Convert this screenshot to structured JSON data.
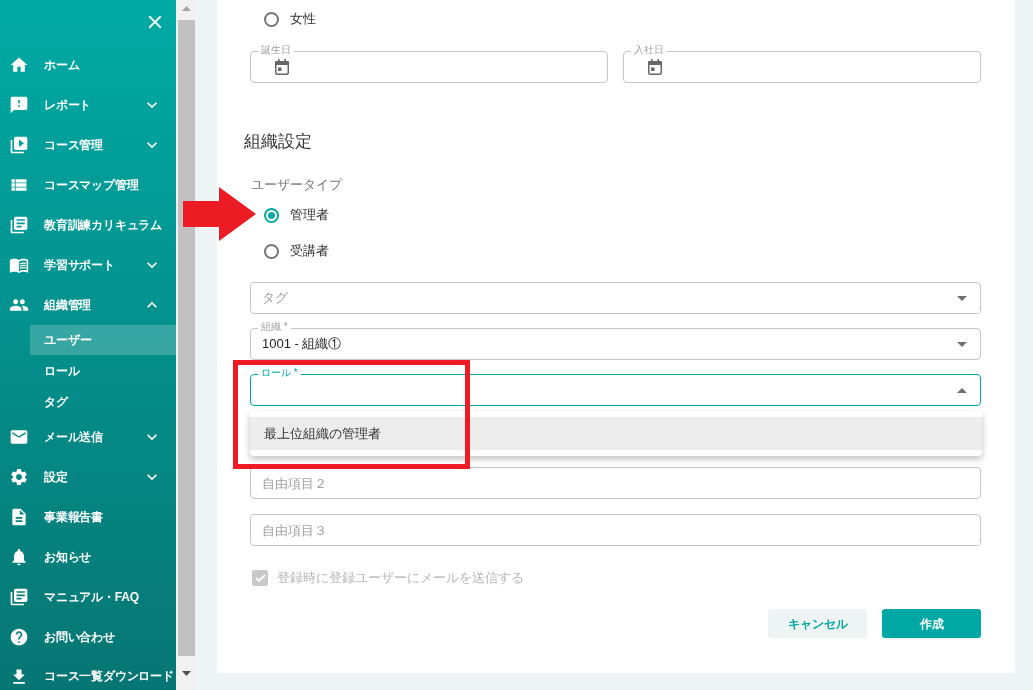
{
  "sidebar": {
    "items": [
      {
        "kind": "link",
        "label": "ホーム"
      },
      {
        "kind": "group",
        "label": "レポート",
        "expanded": false
      },
      {
        "kind": "group",
        "label": "コース管理",
        "expanded": false
      },
      {
        "kind": "link",
        "label": "コースマップ管理"
      },
      {
        "kind": "link",
        "label": "教育訓練カリキュラム"
      },
      {
        "kind": "group",
        "label": "学習サポート",
        "expanded": false
      },
      {
        "kind": "group",
        "label": "組織管理",
        "expanded": true,
        "children": [
          {
            "label": "ユーザー",
            "selected": true
          },
          {
            "label": "ロール",
            "selected": false
          },
          {
            "label": "タグ",
            "selected": false
          }
        ]
      },
      {
        "kind": "group",
        "label": "メール送信",
        "expanded": false
      },
      {
        "kind": "group",
        "label": "設定",
        "expanded": false
      },
      {
        "kind": "link",
        "label": "事業報告書"
      },
      {
        "kind": "link",
        "label": "お知らせ"
      },
      {
        "kind": "link",
        "label": "マニュアル・FAQ"
      },
      {
        "kind": "link",
        "label": "お問い合わせ"
      },
      {
        "kind": "link",
        "label": "コース一覧ダウンロード"
      }
    ]
  },
  "form": {
    "gender_options": [
      {
        "label": "女性",
        "selected": false
      }
    ],
    "date_fields": [
      {
        "label": "誕生日"
      },
      {
        "label": "入社日"
      }
    ],
    "section_title": "組織設定",
    "user_type": {
      "label": "ユーザータイプ",
      "options": [
        {
          "label": "管理者",
          "selected": true
        },
        {
          "label": "受講者",
          "selected": false
        }
      ]
    },
    "selects": [
      {
        "placeholder": "タグ",
        "focused": false,
        "expanded": false
      },
      {
        "label": "組織 *",
        "value": "1001 - 組織①",
        "focused": false,
        "expanded": false
      },
      {
        "label": "ロール *",
        "focused": true,
        "expanded": true,
        "menu": [
          {
            "label": "最上位組織の管理者",
            "highlighted": true
          }
        ]
      }
    ],
    "free_fields": [
      {
        "placeholder": "自由項目２"
      },
      {
        "placeholder": "自由項目３"
      }
    ],
    "notify_checkbox": {
      "label": "登録時に登録ユーザーにメールを送信する",
      "checked": true,
      "disabled": true
    },
    "buttons": [
      {
        "kind": "secondary",
        "label": "キャンセル"
      },
      {
        "kind": "primary",
        "label": "作成"
      }
    ]
  }
}
